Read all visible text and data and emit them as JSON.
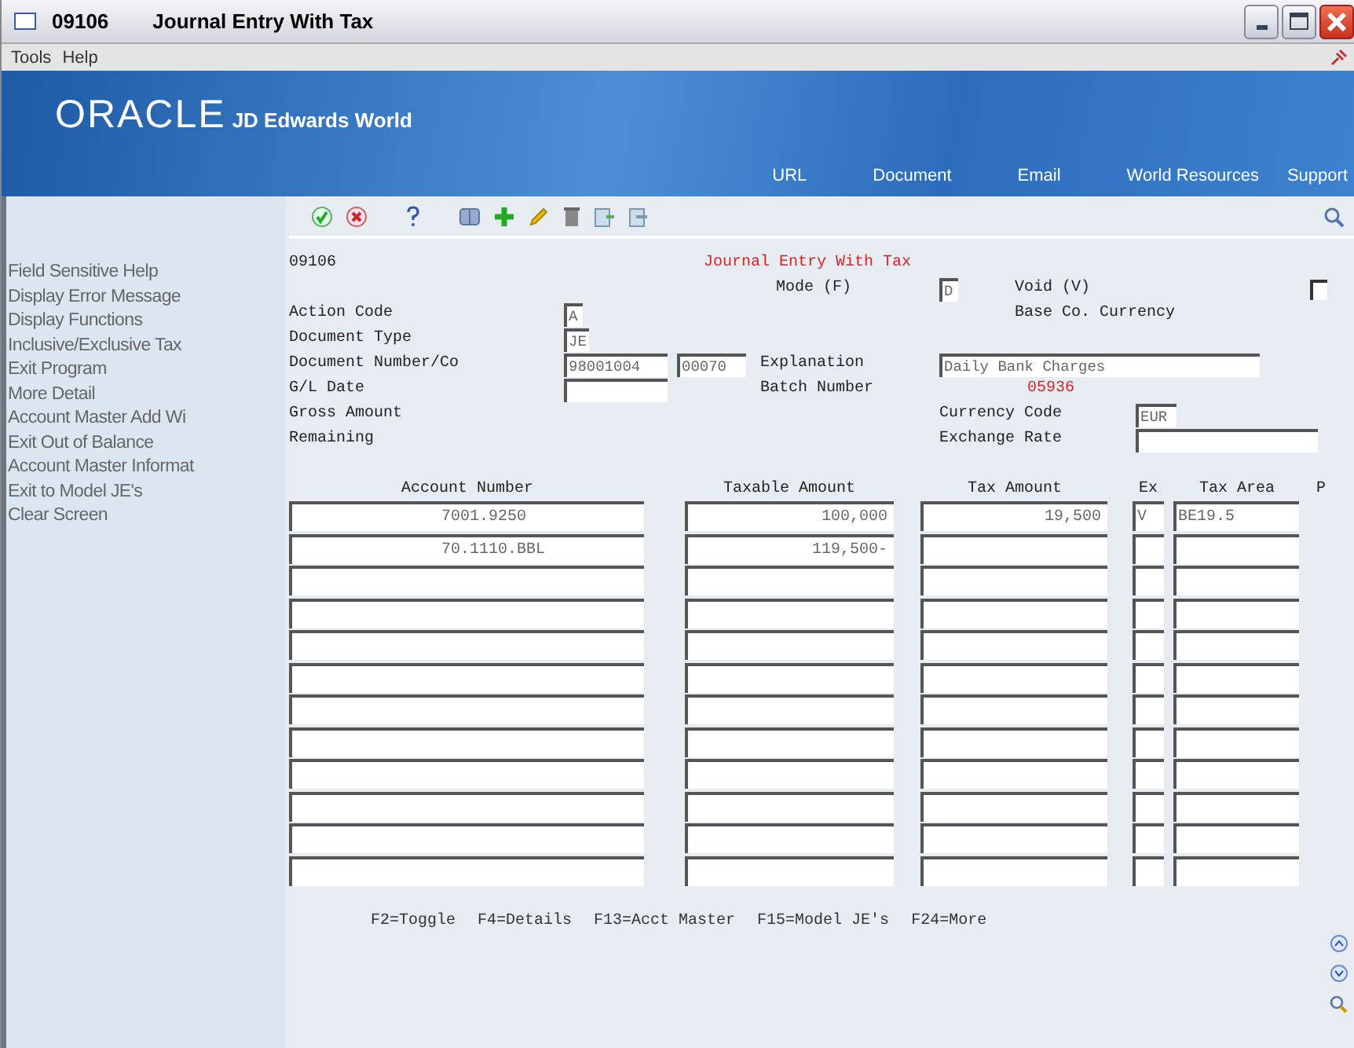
{
  "window": {
    "code": "09106",
    "title": "Journal Entry With Tax"
  },
  "menu": [
    "Tools",
    "Help"
  ],
  "banner": {
    "logo": "ORACLE",
    "product": "JD Edwards World",
    "links": [
      "URL",
      "Document",
      "Email",
      "World Resources",
      "Support"
    ]
  },
  "sidebar": {
    "items": [
      "Field Sensitive Help",
      "Display Error Message",
      "Display Functions",
      "Inclusive/Exclusive Tax",
      "Exit Program",
      "More Detail",
      "Account Master Add Wi",
      "Exit Out of Balance",
      "Account Master Informat",
      "Exit to Model JE's",
      "Clear Screen"
    ]
  },
  "form": {
    "program_id": "09106",
    "title": "Journal Entry With Tax",
    "mode": {
      "label": "Mode (F)",
      "value": "D"
    },
    "void": {
      "label": "Void (V)",
      "checked": false
    },
    "action_code": {
      "label": "Action Code",
      "value": "A"
    },
    "base_currency": {
      "label": "Base Co. Currency"
    },
    "document_type": {
      "label": "Document Type",
      "value": "JE"
    },
    "document_number": {
      "label": "Document Number/Co",
      "value": "98001004",
      "company": "00070"
    },
    "explanation": {
      "label": "Explanation",
      "value": "Daily Bank Charges"
    },
    "gl_date": {
      "label": "G/L Date"
    },
    "batch_number": {
      "label": "Batch Number",
      "value": "05936"
    },
    "gross_amount": {
      "label": "Gross Amount"
    },
    "currency_code": {
      "label": "Currency Code",
      "value": "EUR"
    },
    "remaining": {
      "label": "Remaining"
    },
    "exchange_rate": {
      "label": "Exchange Rate"
    }
  },
  "grid": {
    "columns": [
      "Account Number",
      "Taxable Amount",
      "Tax Amount",
      "Ex",
      "Tax Area",
      "P"
    ],
    "rows": [
      {
        "account": "7001.9250",
        "taxable": "100,000",
        "tax": "19,500",
        "ex": "V",
        "area": "BE19.5"
      },
      {
        "account": "70.1110.BBL",
        "taxable": "119,500-"
      },
      {},
      {},
      {},
      {},
      {},
      {},
      {},
      {},
      {},
      {}
    ]
  },
  "function_keys": [
    "F2=Toggle",
    "F4=Details",
    "F13=Acct Master",
    "F15=Model JE's",
    "F24=More"
  ]
}
